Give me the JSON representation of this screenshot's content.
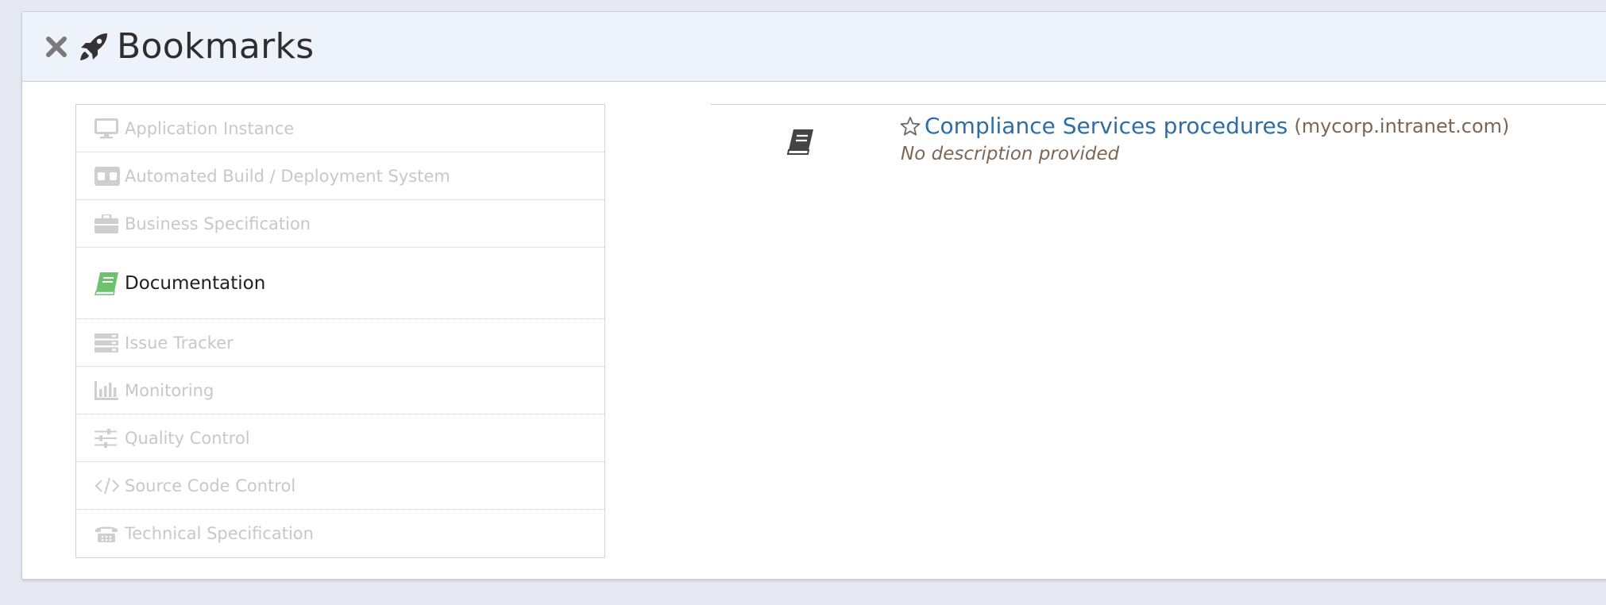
{
  "header": {
    "title": "Bookmarks",
    "close_icon": "close-icon",
    "title_icon": "rocket-icon"
  },
  "categories": [
    {
      "label": "Application Instance",
      "icon": "monitor-icon",
      "active": false
    },
    {
      "label": "Automated Build / Deployment System",
      "icon": "robot-icon",
      "active": false
    },
    {
      "label": "Business Specification",
      "icon": "briefcase-icon",
      "active": false
    },
    {
      "label": "Documentation",
      "icon": "book-icon",
      "active": true
    },
    {
      "label": "Issue Tracker",
      "icon": "server-icon",
      "active": false
    },
    {
      "label": "Monitoring",
      "icon": "bar-chart-icon",
      "active": false
    },
    {
      "label": "Quality Control",
      "icon": "sliders-icon",
      "active": false
    },
    {
      "label": "Source Code Control",
      "icon": "code-icon",
      "active": false
    },
    {
      "label": "Technical Specification",
      "icon": "telephone-icon",
      "active": false
    }
  ],
  "bookmark": {
    "title": "Compliance Services procedures",
    "domain": "(mycorp.intranet.com)",
    "description": "No description provided",
    "type_icon": "book-icon",
    "favorite_icon": "star-outline-icon"
  },
  "colors": {
    "link": "#2d6ea8",
    "active_icon": "#5cb85c",
    "inactive_text": "#c8c8c8",
    "header_bg": "#eef2fa"
  }
}
